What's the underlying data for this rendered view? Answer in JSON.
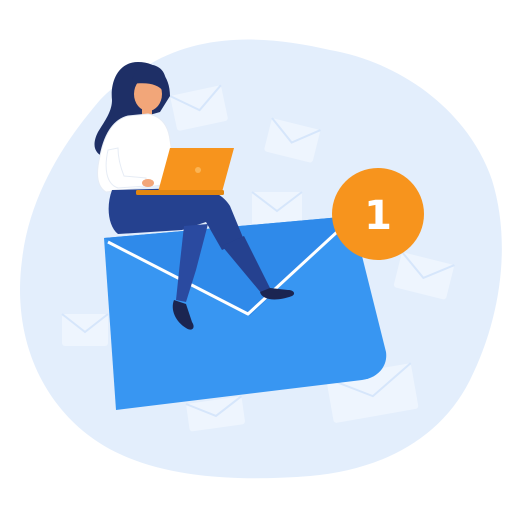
{
  "illustration": {
    "subject": "woman-with-laptop-on-envelope",
    "icons": [
      "envelope-icon",
      "notification-badge",
      "laptop-icon"
    ]
  },
  "notification": {
    "count": "1"
  },
  "colors": {
    "blob": "#e3eefc",
    "background_envelopes": "#eef5fe",
    "main_envelope": "#3896f2",
    "main_envelope_flap": "#2b82e0",
    "envelope_fold_line": "#ffffff",
    "badge": "#f7941d",
    "laptop": "#f7941d",
    "hair": "#1e2f66",
    "skin": "#f2a679",
    "shirt": "#ffffff",
    "pants": "#25418f",
    "shoes": "#1b2551"
  }
}
